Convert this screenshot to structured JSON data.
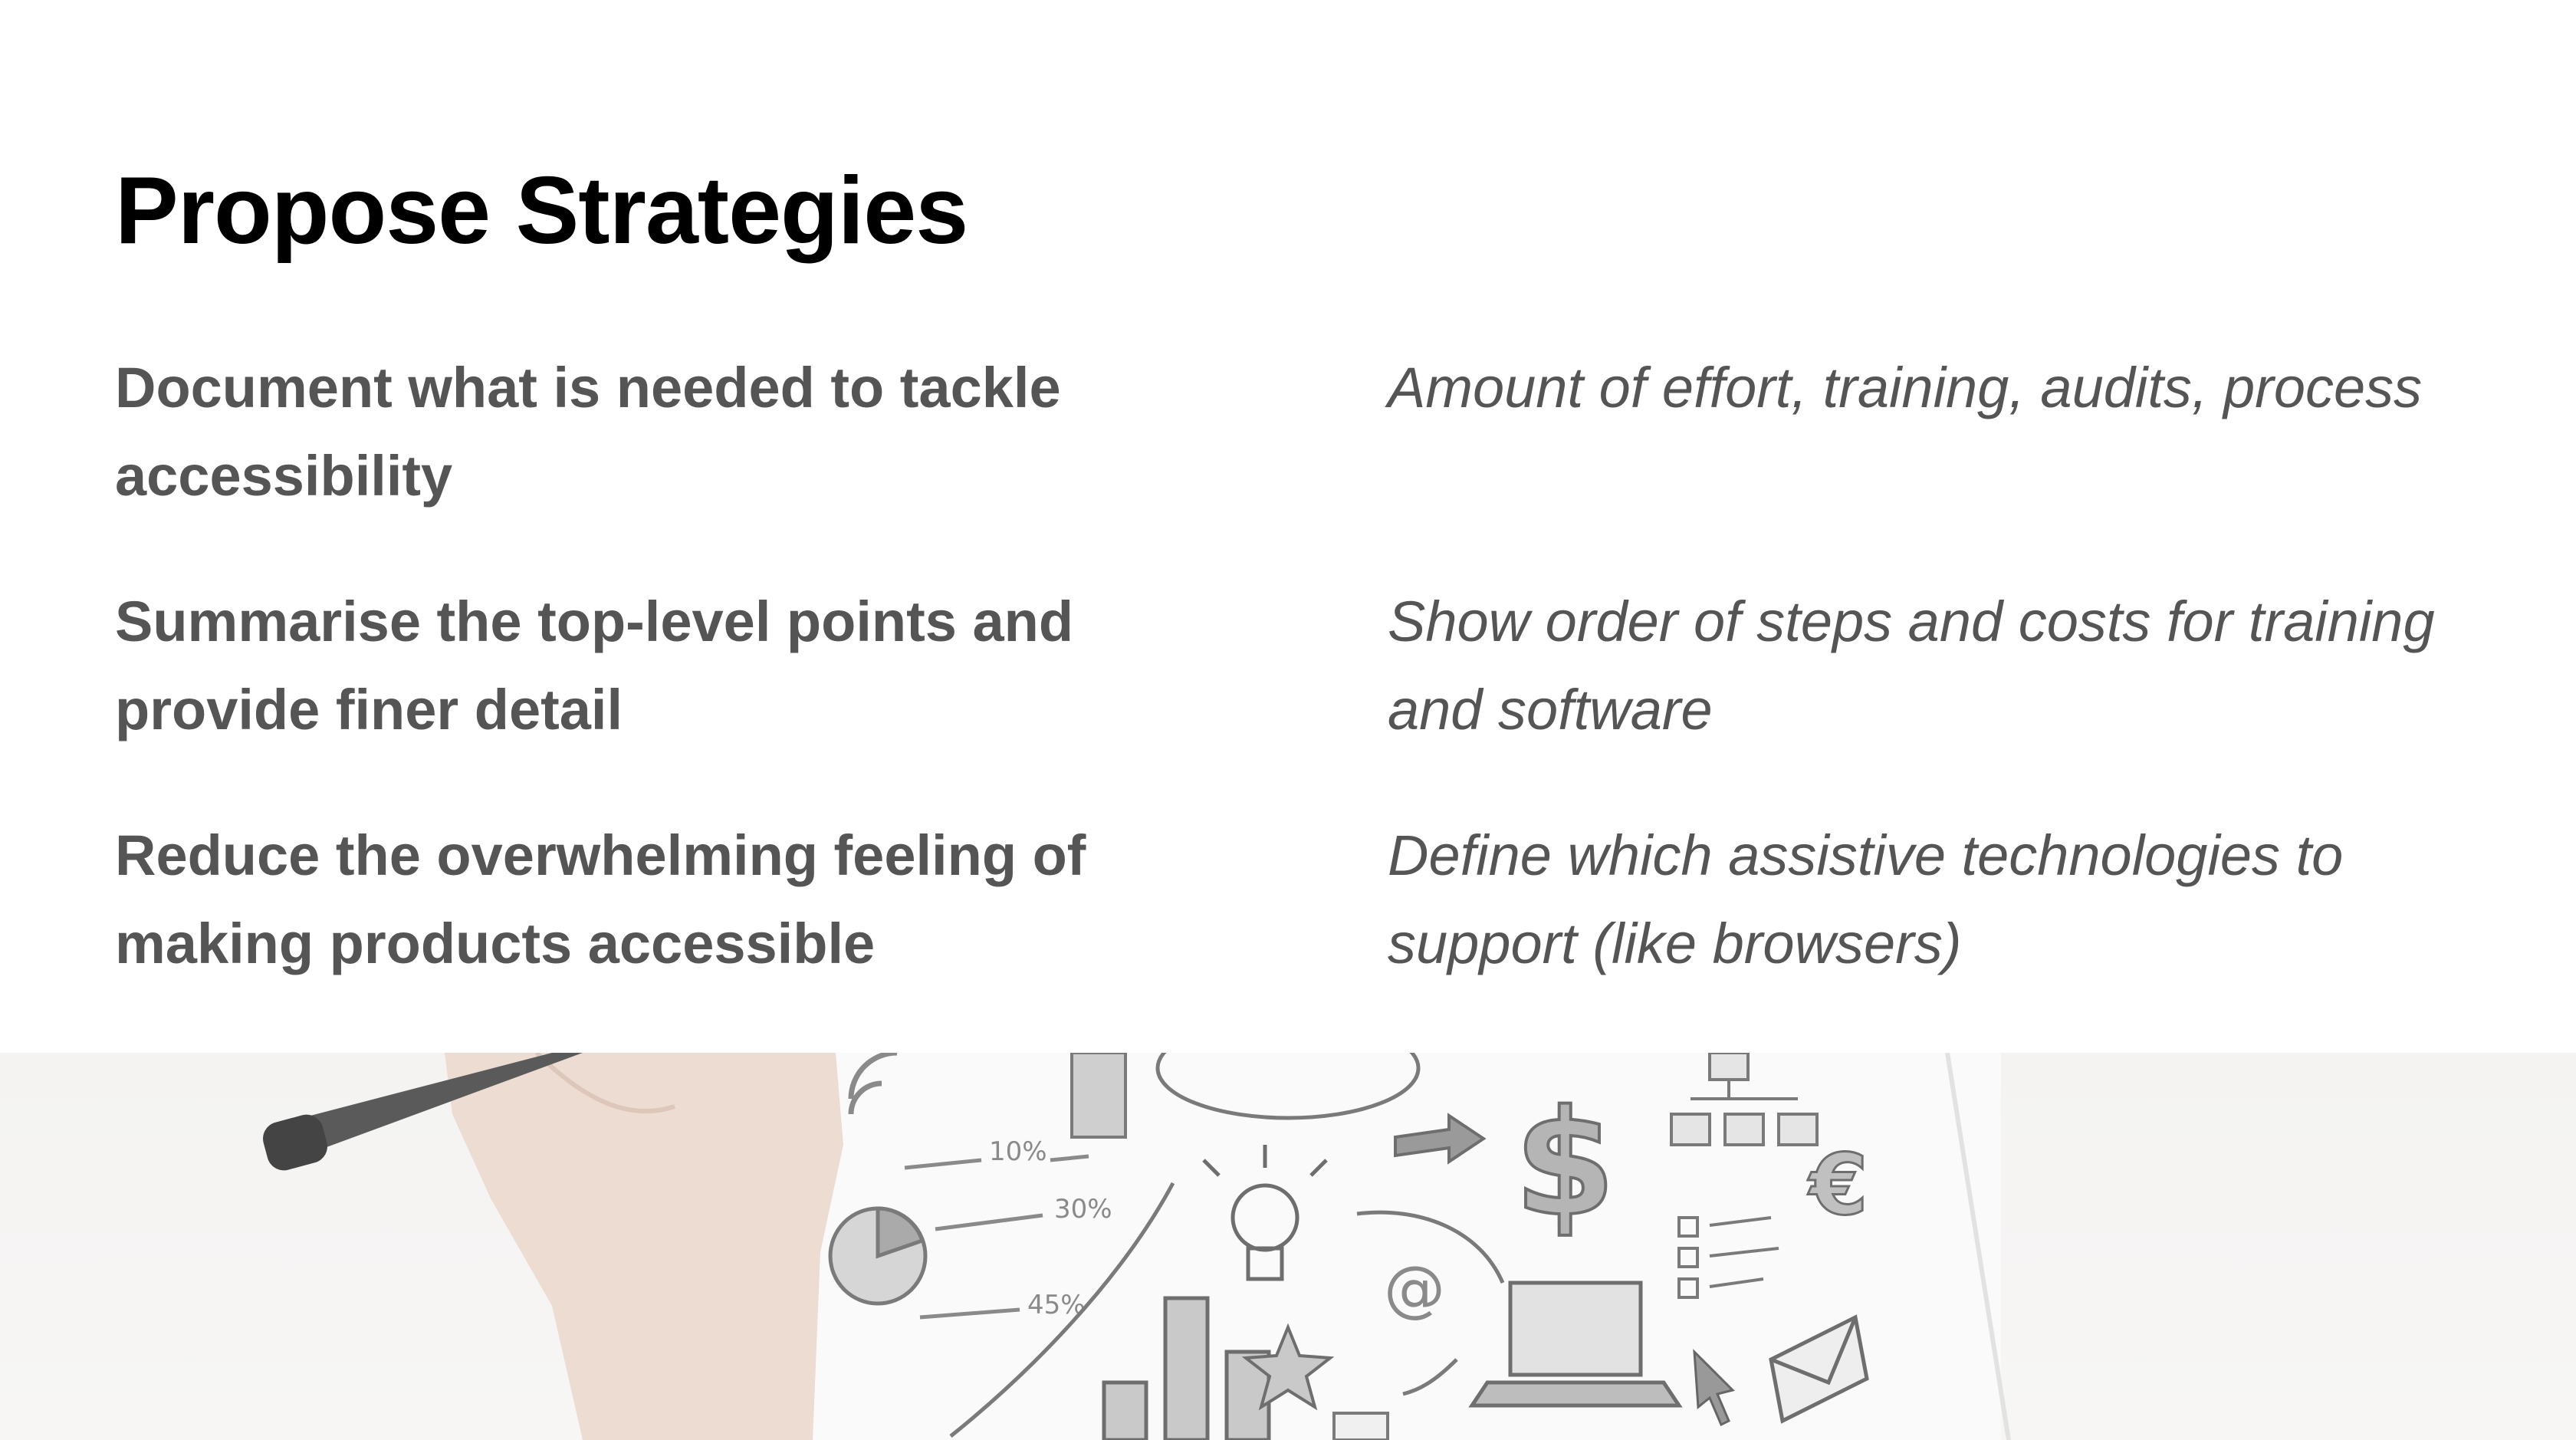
{
  "slide": {
    "title": "Propose Strategies",
    "rows": [
      {
        "point": "Document what is needed to tackle accessibility",
        "detail": "Amount of effort, training, audits, process"
      },
      {
        "point": "Summarise the top-level points and provide finer detail",
        "detail": "Show order of steps and costs for training and software"
      },
      {
        "point": "Reduce the overwhelming feeling of making products accessible",
        "detail": "Define which assistive technologies to support (like browsers)"
      }
    ]
  },
  "photo": {
    "sketch_texts": [
      "10%",
      "30%",
      "45%",
      "$",
      "€",
      "@"
    ],
    "icons": [
      "pen-icon",
      "pie-chart-icon",
      "bar-chart-icon",
      "lightbulb-icon",
      "dollar-icon",
      "euro-icon",
      "laptop-icon",
      "envelope-icon",
      "star-icon",
      "cursor-icon",
      "org-chart-icon",
      "checklist-icon",
      "arrow-icon"
    ],
    "colors": {
      "sketch": "#8a8a8a",
      "skin": "#e8d9cf",
      "background": "#f4f3f2"
    }
  }
}
